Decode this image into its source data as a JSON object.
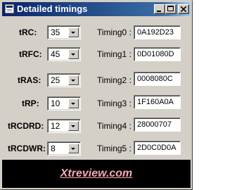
{
  "window": {
    "title": "Detailed timings",
    "icon": "app-window-icon",
    "controls": [
      "minimize-icon",
      "maximize-icon",
      "close-icon"
    ]
  },
  "timings_left": [
    {
      "label": "tRC:",
      "value": "35"
    },
    {
      "label": "tRFC:",
      "value": "45"
    },
    {
      "label": "tRAS:",
      "value": "25"
    },
    {
      "label": "tRP:",
      "value": "10"
    },
    {
      "label": "tRCDRD:",
      "value": "12"
    },
    {
      "label": "tRCDWR:",
      "value": "8"
    }
  ],
  "timings_right": [
    {
      "label": "Timing0 :",
      "value": "0A192D23"
    },
    {
      "label": "Timing1 :",
      "value": "0D01080D"
    },
    {
      "label": "Timing2 :",
      "value": "0008080C"
    },
    {
      "label": "Timing3 :",
      "value": "1F160A0A"
    },
    {
      "label": "Timing4 :",
      "value": "28000707"
    },
    {
      "label": "Timing5 :",
      "value": "2D0C0D0A"
    }
  ],
  "banner": {
    "text": "Xtreview.com",
    "text_color": "#f4a8b0",
    "background": "#000000"
  },
  "colors": {
    "window_face": "#d4d0c8",
    "title_bar": "#0a246a"
  }
}
